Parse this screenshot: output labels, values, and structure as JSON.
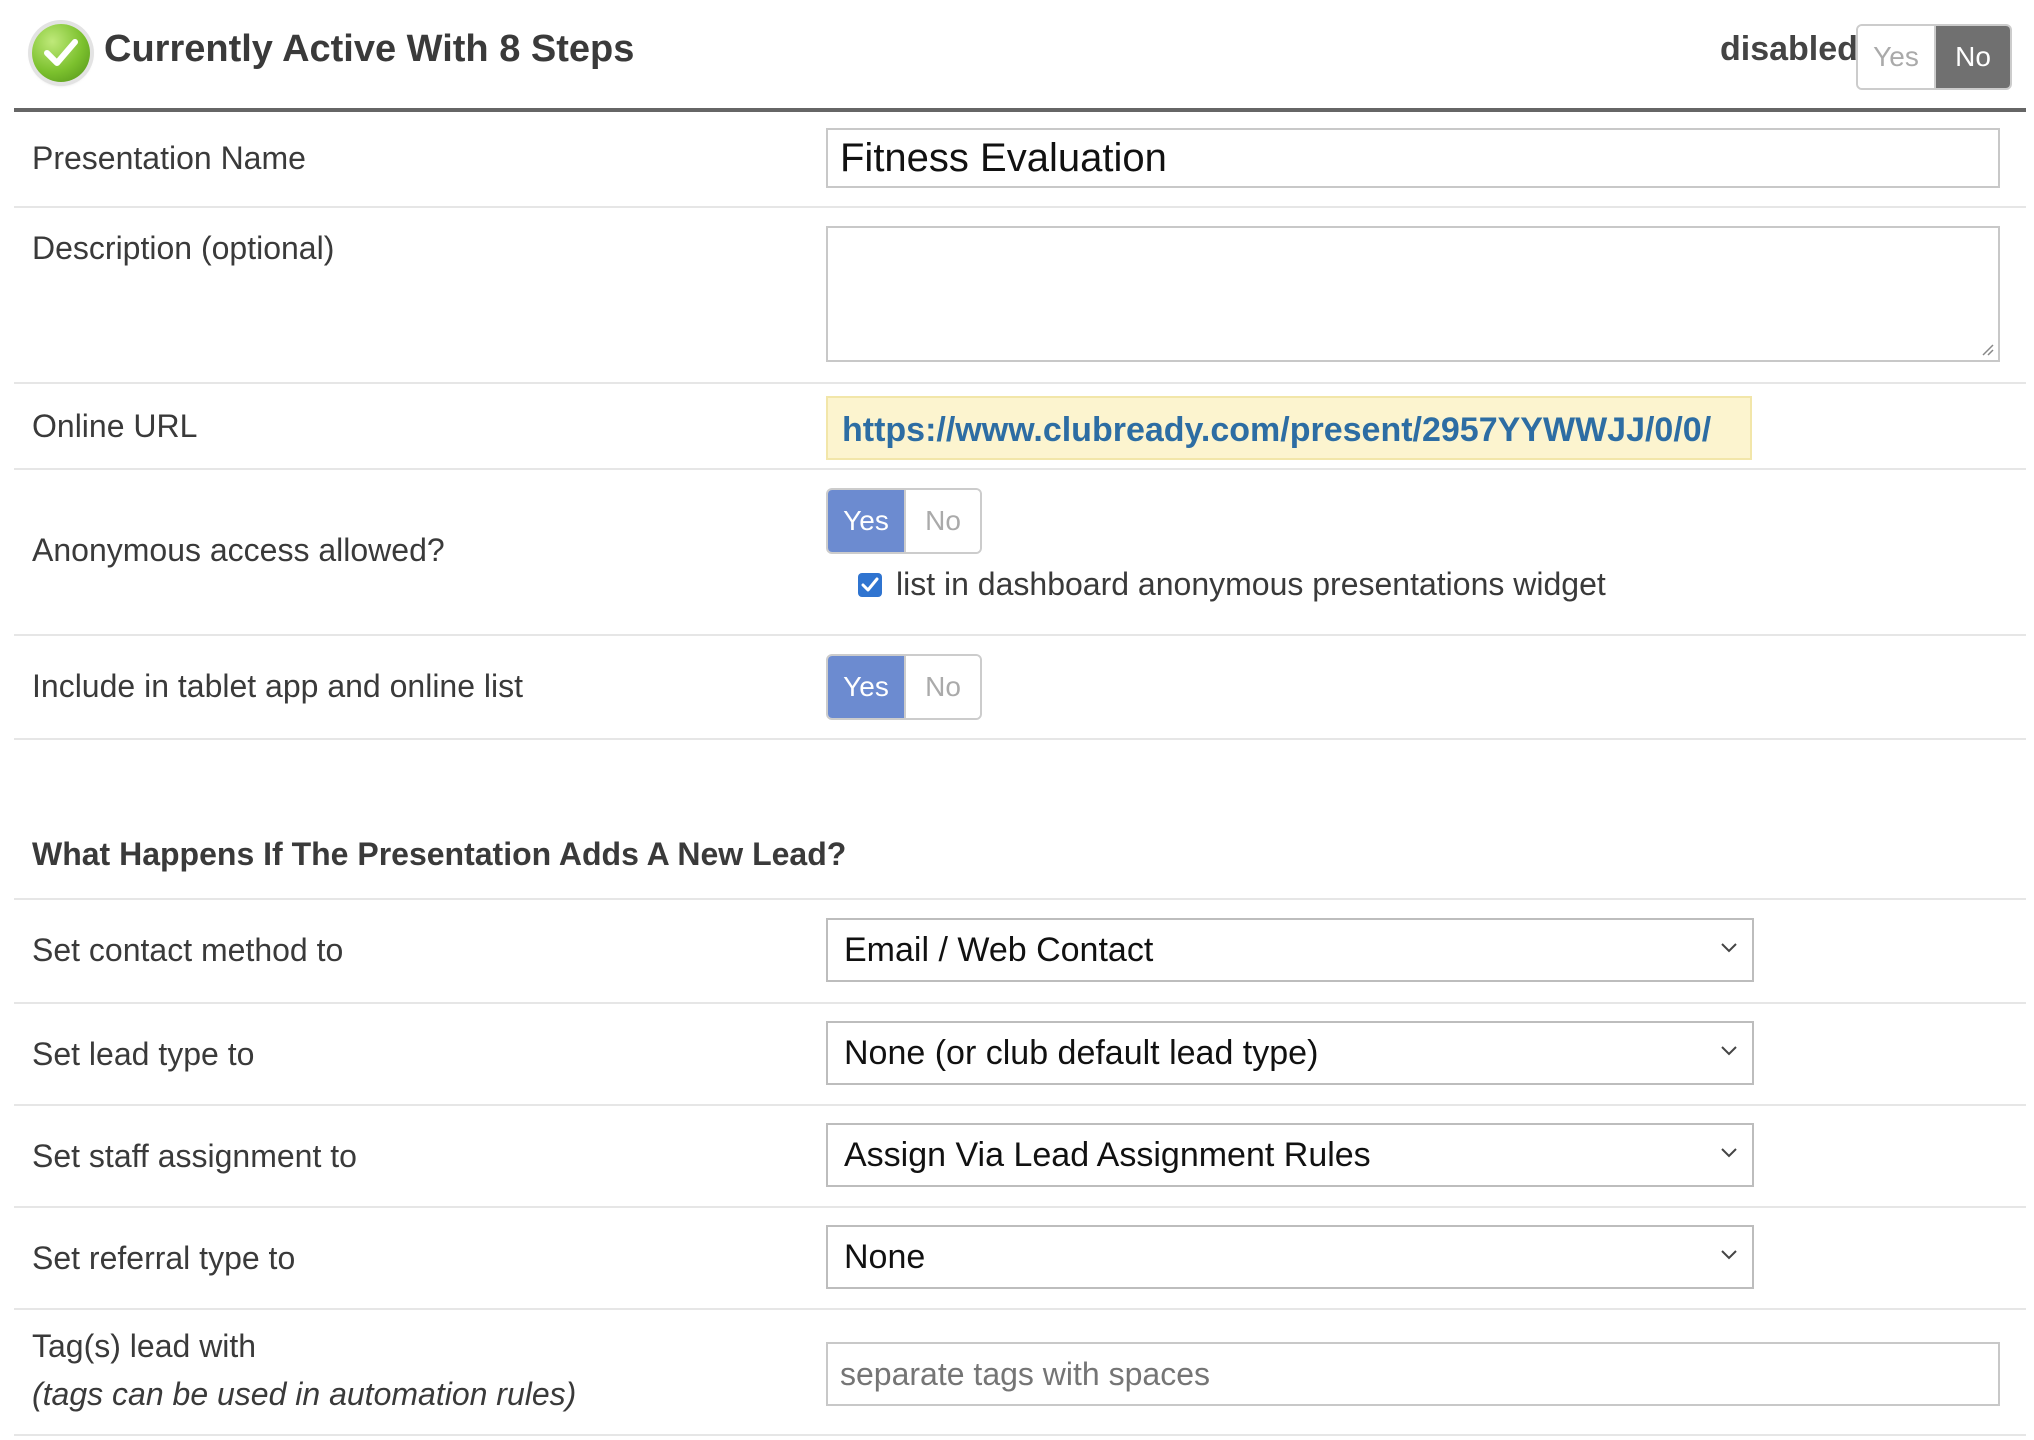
{
  "header": {
    "status_icon": "check-circle-icon",
    "title": "Currently Active With 8 Steps",
    "disabled_label": "disabled",
    "disabled_toggle": {
      "yes": "Yes",
      "no": "No",
      "selected": "No"
    }
  },
  "form": {
    "presentation_name": {
      "label": "Presentation Name",
      "value": "Fitness Evaluation"
    },
    "description": {
      "label": "Description (optional)",
      "value": ""
    },
    "online_url": {
      "label": "Online URL",
      "value": "https://www.clubready.com/present/2957YYWWJJ/0/0/"
    },
    "anonymous_access": {
      "label": "Anonymous access allowed?",
      "toggle": {
        "yes": "Yes",
        "no": "No",
        "selected": "Yes"
      },
      "widget_checkbox": {
        "label": "list in dashboard anonymous presentations widget",
        "checked": true
      }
    },
    "tablet_app": {
      "label": "Include in tablet app and online list",
      "toggle": {
        "yes": "Yes",
        "no": "No",
        "selected": "Yes"
      }
    }
  },
  "lead_section": {
    "heading": "What Happens If The Presentation Adds A New Lead?",
    "contact_method": {
      "label": "Set contact method to",
      "value": "Email / Web Contact"
    },
    "lead_type": {
      "label": "Set lead type to",
      "value": "None (or club default lead type)"
    },
    "staff_assignment": {
      "label": "Set staff assignment to",
      "value": "Assign Via Lead Assignment Rules"
    },
    "referral_type": {
      "label": "Set referral type to",
      "value": "None"
    },
    "tags": {
      "label": "Tag(s) lead with",
      "sublabel": "(tags can be used in automation rules)",
      "placeholder": "separate tags with spaces",
      "value": ""
    }
  },
  "colors": {
    "toggle_active_blue": "#6c8bd0",
    "toggle_active_gray": "#707070",
    "url_background": "#fcf4cf",
    "url_text": "#2d6da3",
    "status_green": "#7cc12e",
    "checkbox_blue": "#2f74d0"
  }
}
